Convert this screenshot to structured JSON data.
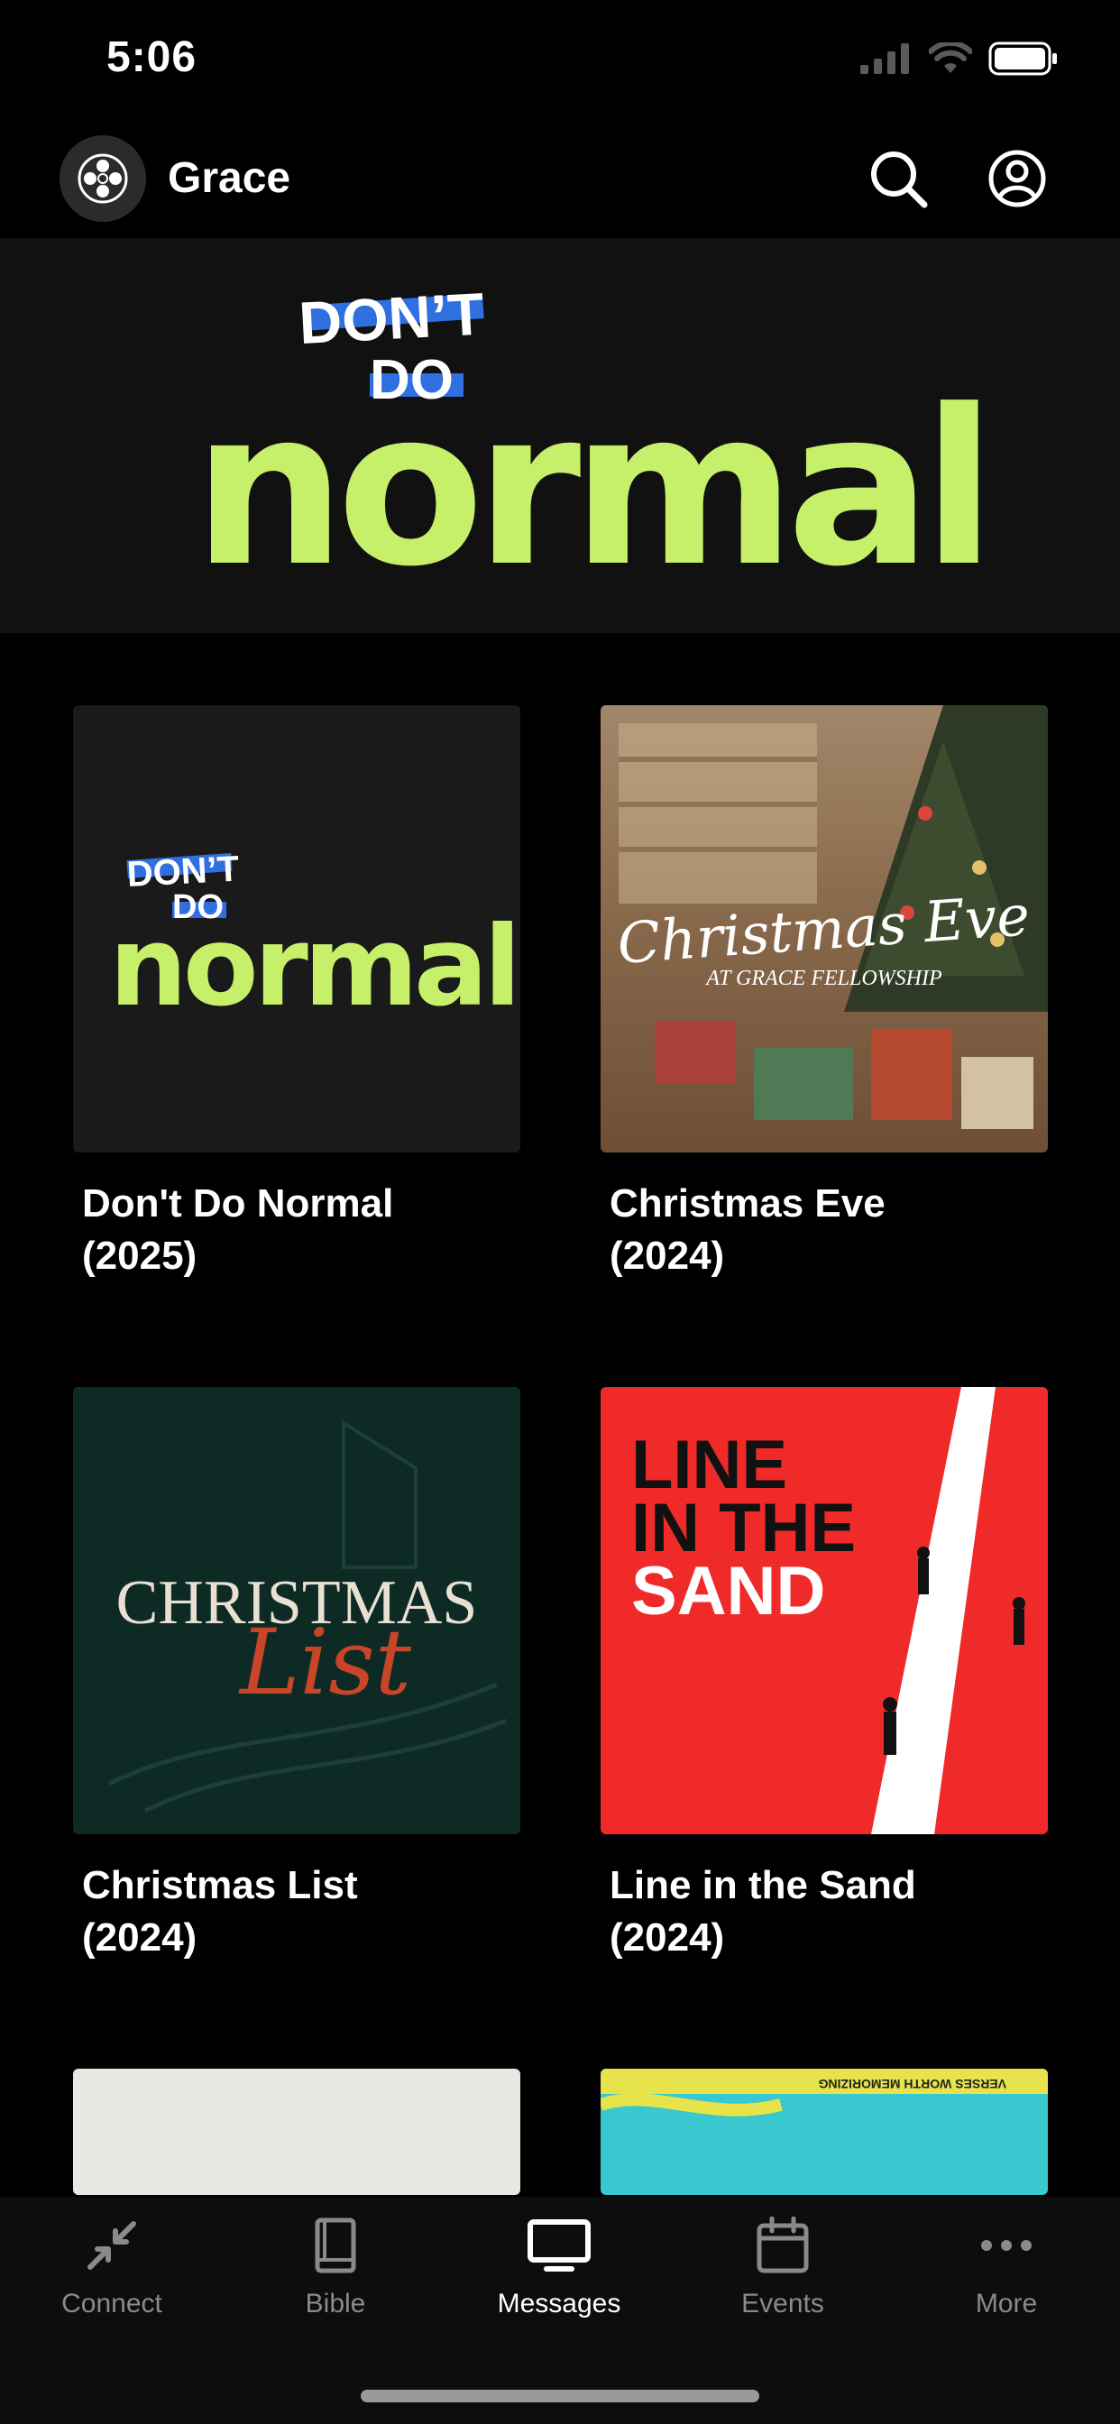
{
  "status": {
    "time": "5:06"
  },
  "header": {
    "brand_name": "Grace"
  },
  "hero": {
    "art_line1": "DON’T",
    "art_line2": "DO",
    "art_word": "normal"
  },
  "series": [
    {
      "title": "Don't Do Normal\n(2025)",
      "art": {
        "line1": "DON’T",
        "line2": "DO",
        "word": "normal"
      }
    },
    {
      "title": "Christmas Eve\n(2024)",
      "art": {
        "script": "Christmas Eve",
        "subtitle": "AT GRACE FELLOWSHIP"
      }
    },
    {
      "title": "Christmas List\n(2024)",
      "art": {
        "line1": "CHRISTMAS",
        "line2": "List"
      }
    },
    {
      "title": "Line in the Sand\n(2024)",
      "art": {
        "line1": "LINE",
        "line2": "IN THE",
        "line3": "SAND"
      }
    }
  ],
  "peek": {
    "art_text": "VERSES WORTH MEMORIZING"
  },
  "tabs": [
    {
      "label": "Connect",
      "icon": "connect-icon",
      "active": false
    },
    {
      "label": "Bible",
      "icon": "book-icon",
      "active": false
    },
    {
      "label": "Messages",
      "icon": "tv-icon",
      "active": true
    },
    {
      "label": "Events",
      "icon": "calendar-icon",
      "active": false
    },
    {
      "label": "More",
      "icon": "more-icon",
      "active": false
    }
  ],
  "colors": {
    "lime": "#c6f06a",
    "blue": "#2f6fe0",
    "red": "#ef2a28",
    "dark_green": "#0e2a24",
    "rust": "#c8452a"
  }
}
